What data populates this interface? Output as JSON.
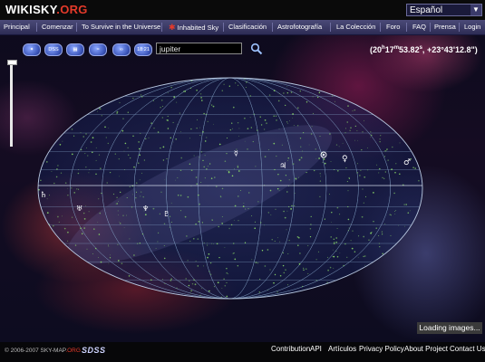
{
  "header": {
    "logo_main": "WIKISKY",
    "logo_suffix": ".ORG",
    "language": "Español"
  },
  "nav": {
    "items": [
      "Principal",
      "Comenzar",
      "To Survive in the Universe",
      "Inhabited Sky",
      "Clasificación",
      "Astrofotografía",
      "La Colección",
      "Foro",
      "FAQ",
      "Prensa",
      "Login"
    ]
  },
  "toolbar": {
    "buttons": [
      "",
      "DSS",
      "",
      "",
      "",
      "18:21"
    ],
    "search_value": "jupiter"
  },
  "coords": {
    "ra_h": "20",
    "ra_m": "17",
    "ra_s": "53.82",
    "dec": "+23°43'12.8\""
  },
  "status": {
    "loading": "Loading images..."
  },
  "footer": {
    "copyright_pre": "© 2006-2007 SKY-MAP",
    "copyright_red": ".ORG",
    "sdss": "SDSS",
    "links": [
      "Contribution",
      "API",
      "Artículos",
      "Privacy Policy",
      "About Project",
      "Contact Us"
    ]
  },
  "colors": {
    "accent_red": "#e53a2a",
    "nav_bg": "#3c3b6a",
    "grid": "#6f8fb0",
    "stars": "#7bd65a"
  }
}
